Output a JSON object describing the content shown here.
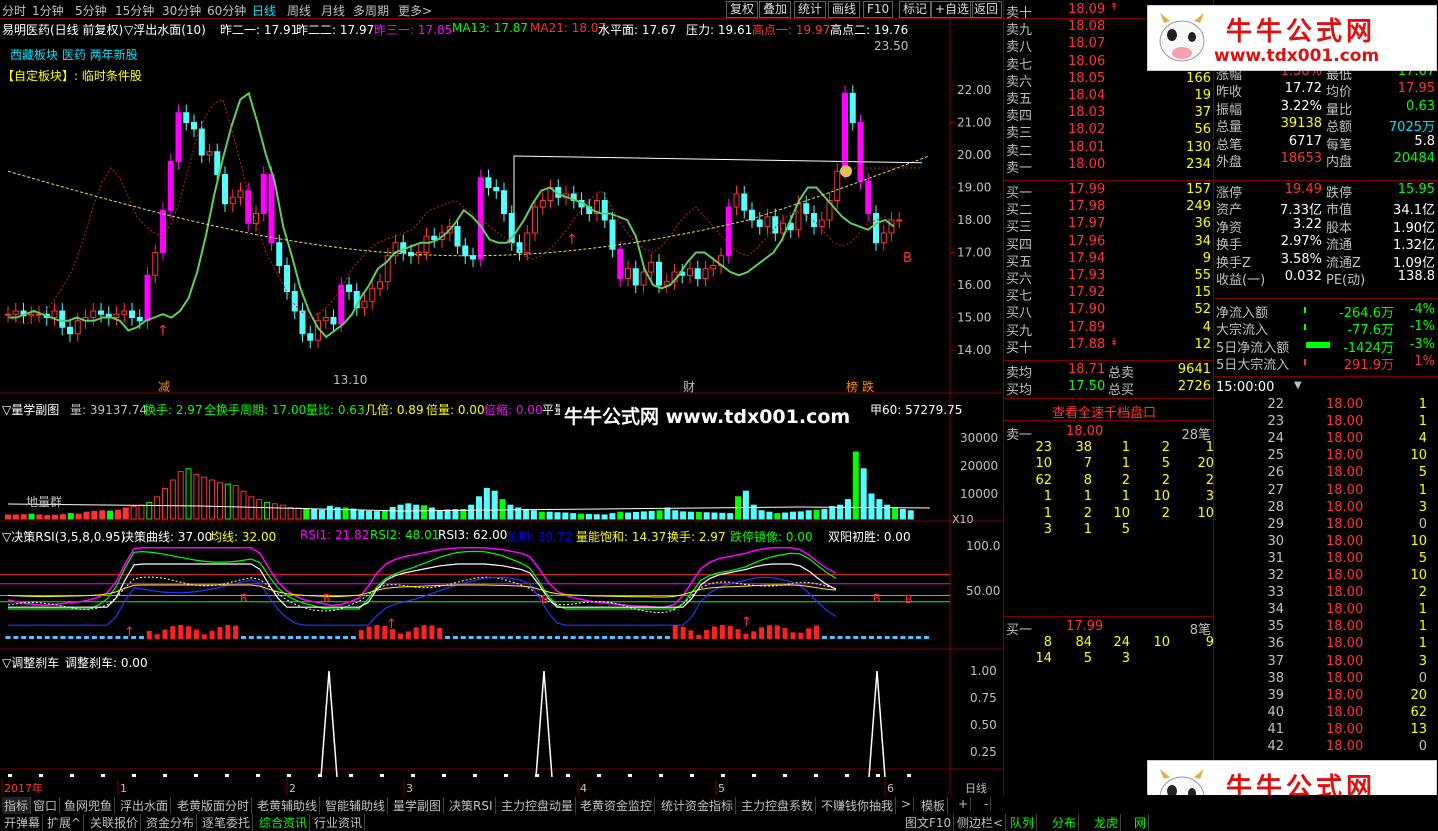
{
  "topbar": {
    "periods": [
      "分时",
      "1分钟",
      "5分钟",
      "15分钟",
      "30分钟",
      "60分钟",
      "日线",
      "周线",
      "月线",
      "多周期",
      "更多>"
    ],
    "buttons": [
      "复权",
      "叠加",
      "统计",
      "画线",
      "F10",
      "标记",
      "+自选",
      "返回"
    ]
  },
  "chart": {
    "title": "易明医药(日线 前复权)",
    "indicator": "▽浮出水面(10)",
    "params": [
      {
        "t": "昨二一: 17.91",
        "c": "#ffffff"
      },
      {
        "t": "昨二二: 17.97",
        "c": "#ffffff"
      },
      {
        "t": "昨三一: 17.85",
        "c": "#ff00ff"
      },
      {
        "t": "MA13: 17.87",
        "c": "#00ff00"
      },
      {
        "t": "MA21: 18.07",
        "c": "#ff3333"
      },
      {
        "t": "水平面: 17.67",
        "c": "#ffffff"
      },
      {
        "t": "压力: 19.61",
        "c": "#ffffff"
      },
      {
        "t": "高点一: 19.97",
        "c": "#ff3333"
      },
      {
        "t": "高点二: 19.76",
        "c": "#ffffff"
      }
    ],
    "block_line": "西藏板块  医药  两年新股",
    "custom_block": "【自定板块】: 临时条件股",
    "price_axis": [
      "22.00",
      "21.00",
      "20.00",
      "19.00",
      "18.00",
      "17.00",
      "16.00",
      "15.00",
      "14.00"
    ],
    "high_label": "23.50",
    "low_label": "13.10",
    "markers": [
      "减",
      "财",
      "榜",
      "跌"
    ],
    "signal_b": "B"
  },
  "vol_panel": {
    "header": "▽量学副图",
    "items": [
      {
        "t": "量: 39137.74",
        "c": "#c0c0c0"
      },
      {
        "t": "换手: 2.97",
        "c": "#00ff00"
      },
      {
        "t": "全换手周期: 17.00",
        "c": "#00ff00"
      },
      {
        "t": "量比: 0.63",
        "c": "#00ff00"
      },
      {
        "t": "几倍: 0.89",
        "c": "#ffff00"
      },
      {
        "t": "倍量: 0.00",
        "c": "#ffff00"
      },
      {
        "t": "倍缩: 0.00",
        "c": "#ff00ff"
      },
      {
        "t": "平量",
        "c": "#ffffff"
      }
    ],
    "right_val": "甲60: 57279.75",
    "axis": [
      "30000",
      "20000",
      "10000",
      "X10"
    ],
    "ground_label": "地量群"
  },
  "rsi_panel": {
    "header": "▽决策RSI(3,5,8,0.95)",
    "items": [
      {
        "t": "决策曲线: 37.00",
        "c": "#ffffff"
      },
      {
        "t": "均线: 32.00",
        "c": "#ffff00"
      },
      {
        "t": "RSI1: 21.82",
        "c": "#ff00ff"
      },
      {
        "t": "RSI2: 48.01",
        "c": "#00ff00"
      },
      {
        "t": "RSI3: 62.00",
        "c": "#ffffff"
      },
      {
        "t": "长期: 39.72",
        "c": "#0000ff"
      },
      {
        "t": "量能饱和: 14.37",
        "c": "#ffff00"
      },
      {
        "t": "换手: 2.97",
        "c": "#ffff00"
      },
      {
        "t": "跌停镜像: 0.00",
        "c": "#00ff00"
      },
      {
        "t": "双阳初胜: 0.00",
        "c": "#ffffff"
      }
    ],
    "axis": [
      "100.0",
      "50.00"
    ]
  },
  "brake_panel": {
    "header": "▽调整刹车",
    "item": "调整刹车: 0.00",
    "axis": [
      "1.00",
      "0.75",
      "0.50",
      "0.25"
    ]
  },
  "date_axis": [
    "2017年",
    "1",
    "2",
    "3",
    "4",
    "5",
    "6",
    "日线"
  ],
  "watermark": {
    "text": "牛牛公式网",
    "url": "www.tdx001.com",
    "center": "牛牛公式网 www.tdx001.com"
  },
  "quote": {
    "sells": [
      {
        "n": "卖十",
        "p": "18.09",
        "v": "",
        "arrow": "↟"
      },
      {
        "n": "卖九",
        "p": "18.08",
        "v": ""
      },
      {
        "n": "卖八",
        "p": "18.07",
        "v": ""
      },
      {
        "n": "卖七",
        "p": "18.06",
        "v": ""
      },
      {
        "n": "卖六",
        "p": "18.05",
        "v": "166"
      },
      {
        "n": "卖五",
        "p": "18.04",
        "v": "19"
      },
      {
        "n": "卖四",
        "p": "18.03",
        "v": "37"
      },
      {
        "n": "卖三",
        "p": "18.02",
        "v": "56"
      },
      {
        "n": "卖二",
        "p": "18.01",
        "v": "130"
      },
      {
        "n": "卖一",
        "p": "18.00",
        "v": "234"
      }
    ],
    "buys": [
      {
        "n": "买一",
        "p": "17.99",
        "v": "157"
      },
      {
        "n": "买二",
        "p": "17.98",
        "v": "249"
      },
      {
        "n": "买三",
        "p": "17.97",
        "v": "36"
      },
      {
        "n": "买四",
        "p": "17.96",
        "v": "34"
      },
      {
        "n": "买五",
        "p": "17.94",
        "v": "9"
      },
      {
        "n": "买六",
        "p": "17.93",
        "v": "55"
      },
      {
        "n": "买七",
        "p": "17.92",
        "v": "15"
      },
      {
        "n": "买八",
        "p": "17.90",
        "v": "52"
      },
      {
        "n": "买九",
        "p": "17.89",
        "v": "4"
      },
      {
        "n": "买十",
        "p": "17.88",
        "v": "12",
        "arrow": "↡"
      }
    ],
    "avg": [
      {
        "n": "卖均",
        "p": "18.71",
        "k": "总卖",
        "v": "9641"
      },
      {
        "n": "买均",
        "p": "17.50",
        "k": "总买",
        "v": "2726"
      }
    ],
    "stats": [
      {
        "k": "涨幅",
        "v": "1.58%",
        "k2": "最低",
        "v2": "17.67",
        "c1": "#ff3333",
        "c2": "#00ff00"
      },
      {
        "k": "昨收",
        "v": "17.72",
        "k2": "均价",
        "v2": "17.95",
        "c1": "#ffffff",
        "c2": "#ff3333"
      },
      {
        "k": "振幅",
        "v": "3.22%",
        "k2": "量比",
        "v2": "0.63",
        "c1": "#ffffff",
        "c2": "#00ff00"
      },
      {
        "k": "总量",
        "v": "39138",
        "k2": "总额",
        "v2": "7025万",
        "c1": "#ffff00",
        "c2": "#00e5ff"
      },
      {
        "k": "总笔",
        "v": "6717",
        "k2": "每笔",
        "v2": "5.8",
        "c1": "#ffffff",
        "c2": "#ffffff"
      },
      {
        "k": "外盘",
        "v": "18653",
        "k2": "内盘",
        "v2": "20484",
        "c1": "#ff3333",
        "c2": "#00ff00"
      },
      {
        "k": "涨停",
        "v": "19.49",
        "k2": "跌停",
        "v2": "15.95",
        "c1": "#ff3333",
        "c2": "#00ff00"
      },
      {
        "k": "资产",
        "v": "7.33亿",
        "k2": "市值",
        "v2": "34.1亿",
        "c1": "#ffffff",
        "c2": "#ffffff"
      },
      {
        "k": "净资",
        "v": "3.22",
        "k2": "股本",
        "v2": "1.90亿",
        "c1": "#ffffff",
        "c2": "#ffffff"
      },
      {
        "k": "换手",
        "v": "2.97%",
        "k2": "流通",
        "v2": "1.32亿",
        "c1": "#ffffff",
        "c2": "#ffffff"
      },
      {
        "k": "换手Z",
        "v": "3.58%",
        "k2": "流通Z",
        "v2": "1.09亿",
        "c1": "#ffffff",
        "c2": "#ffffff"
      },
      {
        "k": "收益(一)",
        "v": "0.032",
        "k2": "PE(动)",
        "v2": "138.8",
        "c1": "#ffffff",
        "c2": "#ffffff"
      }
    ],
    "flows": [
      {
        "k": "净流入额",
        "v": "-264.6万",
        "p": "-4%",
        "c": "#00ff00"
      },
      {
        "k": "大宗流入",
        "v": "-77.6万",
        "p": "-1%",
        "c": "#00ff00"
      },
      {
        "k": "5日净流入额",
        "v": "-1424万",
        "p": "-3%",
        "c": "#00ff00"
      },
      {
        "k": "5日大宗流入",
        "v": "291.9万",
        "p": "1%",
        "c": "#ff3333"
      }
    ]
  },
  "level2": {
    "link": "查看全速千档盘口",
    "sell1": {
      "n": "卖一",
      "p": "18.00",
      "v": "28笔"
    },
    "sell_rows": [
      [
        "23",
        "38",
        "1",
        "2",
        "1"
      ],
      [
        "10",
        "7",
        "1",
        "5",
        "20"
      ],
      [
        "62",
        "8",
        "2",
        "2",
        "2"
      ],
      [
        "1",
        "1",
        "1",
        "10",
        "3"
      ],
      [
        "1",
        "2",
        "10",
        "2",
        "10"
      ],
      [
        "3",
        "1",
        "5",
        "",
        ""
      ]
    ],
    "buy1": {
      "n": "买一",
      "p": "17.99",
      "v": "8笔"
    },
    "buy_rows": [
      [
        "8",
        "84",
        "24",
        "10",
        "9"
      ],
      [
        "14",
        "5",
        "3",
        "",
        ""
      ]
    ]
  },
  "ticks": {
    "head": "15:00:00",
    "rows": [
      [
        "22",
        "18.00",
        "1"
      ],
      [
        "23",
        "18.00",
        "1"
      ],
      [
        "24",
        "18.00",
        "4"
      ],
      [
        "25",
        "18.00",
        "10"
      ],
      [
        "26",
        "18.00",
        "5"
      ],
      [
        "27",
        "18.00",
        "1"
      ],
      [
        "28",
        "18.00",
        "3"
      ],
      [
        "29",
        "18.00",
        "0"
      ],
      [
        "30",
        "18.00",
        "10"
      ],
      [
        "31",
        "18.00",
        "5"
      ],
      [
        "32",
        "18.00",
        "10"
      ],
      [
        "33",
        "18.00",
        "2"
      ],
      [
        "34",
        "18.00",
        "1"
      ],
      [
        "35",
        "18.00",
        "1"
      ],
      [
        "36",
        "18.00",
        "1"
      ],
      [
        "37",
        "18.00",
        "3"
      ],
      [
        "38",
        "18.00",
        "0"
      ],
      [
        "39",
        "18.00",
        "20"
      ],
      [
        "40",
        "18.00",
        "62"
      ],
      [
        "41",
        "18.00",
        "13"
      ],
      [
        "42",
        "18.00",
        "0"
      ]
    ],
    "colors": [
      "#ffff00",
      "#ffff00",
      "#ffff00",
      "#ffff00",
      "#ffff00",
      "#ffff00",
      "#ffff00",
      "#c0c0c0",
      "#ffff00",
      "#ffff00",
      "#ffff00",
      "#ffff00",
      "#ffff00",
      "#ffff00",
      "#ffff00",
      "#ffff00",
      "#c0c0c0",
      "#ffff00",
      "#ffff00",
      "#ffff00",
      "#c0c0c0"
    ]
  },
  "bottom": {
    "row1": [
      "指标",
      "窗口",
      "鱼网兜鱼",
      "浮出水面",
      "老黄版面分时",
      "老黄辅助线",
      "智能辅助线",
      "量学副图",
      "决策RSI",
      "主力控盘动量",
      "老黄资金监控",
      "统计资金指标",
      "主力控盘系数",
      "不赚钱你抽我",
      ">",
      "模板",
      "+",
      "-"
    ],
    "row2": [
      "开弹幕",
      "扩展^",
      "关联报价",
      "资金分布",
      "逐笔委托",
      "综合资讯",
      "行业资讯"
    ],
    "row2_right": [
      "图文F10",
      "侧边栏<",
      "队列",
      "分布",
      "龙虎",
      "网"
    ]
  }
}
